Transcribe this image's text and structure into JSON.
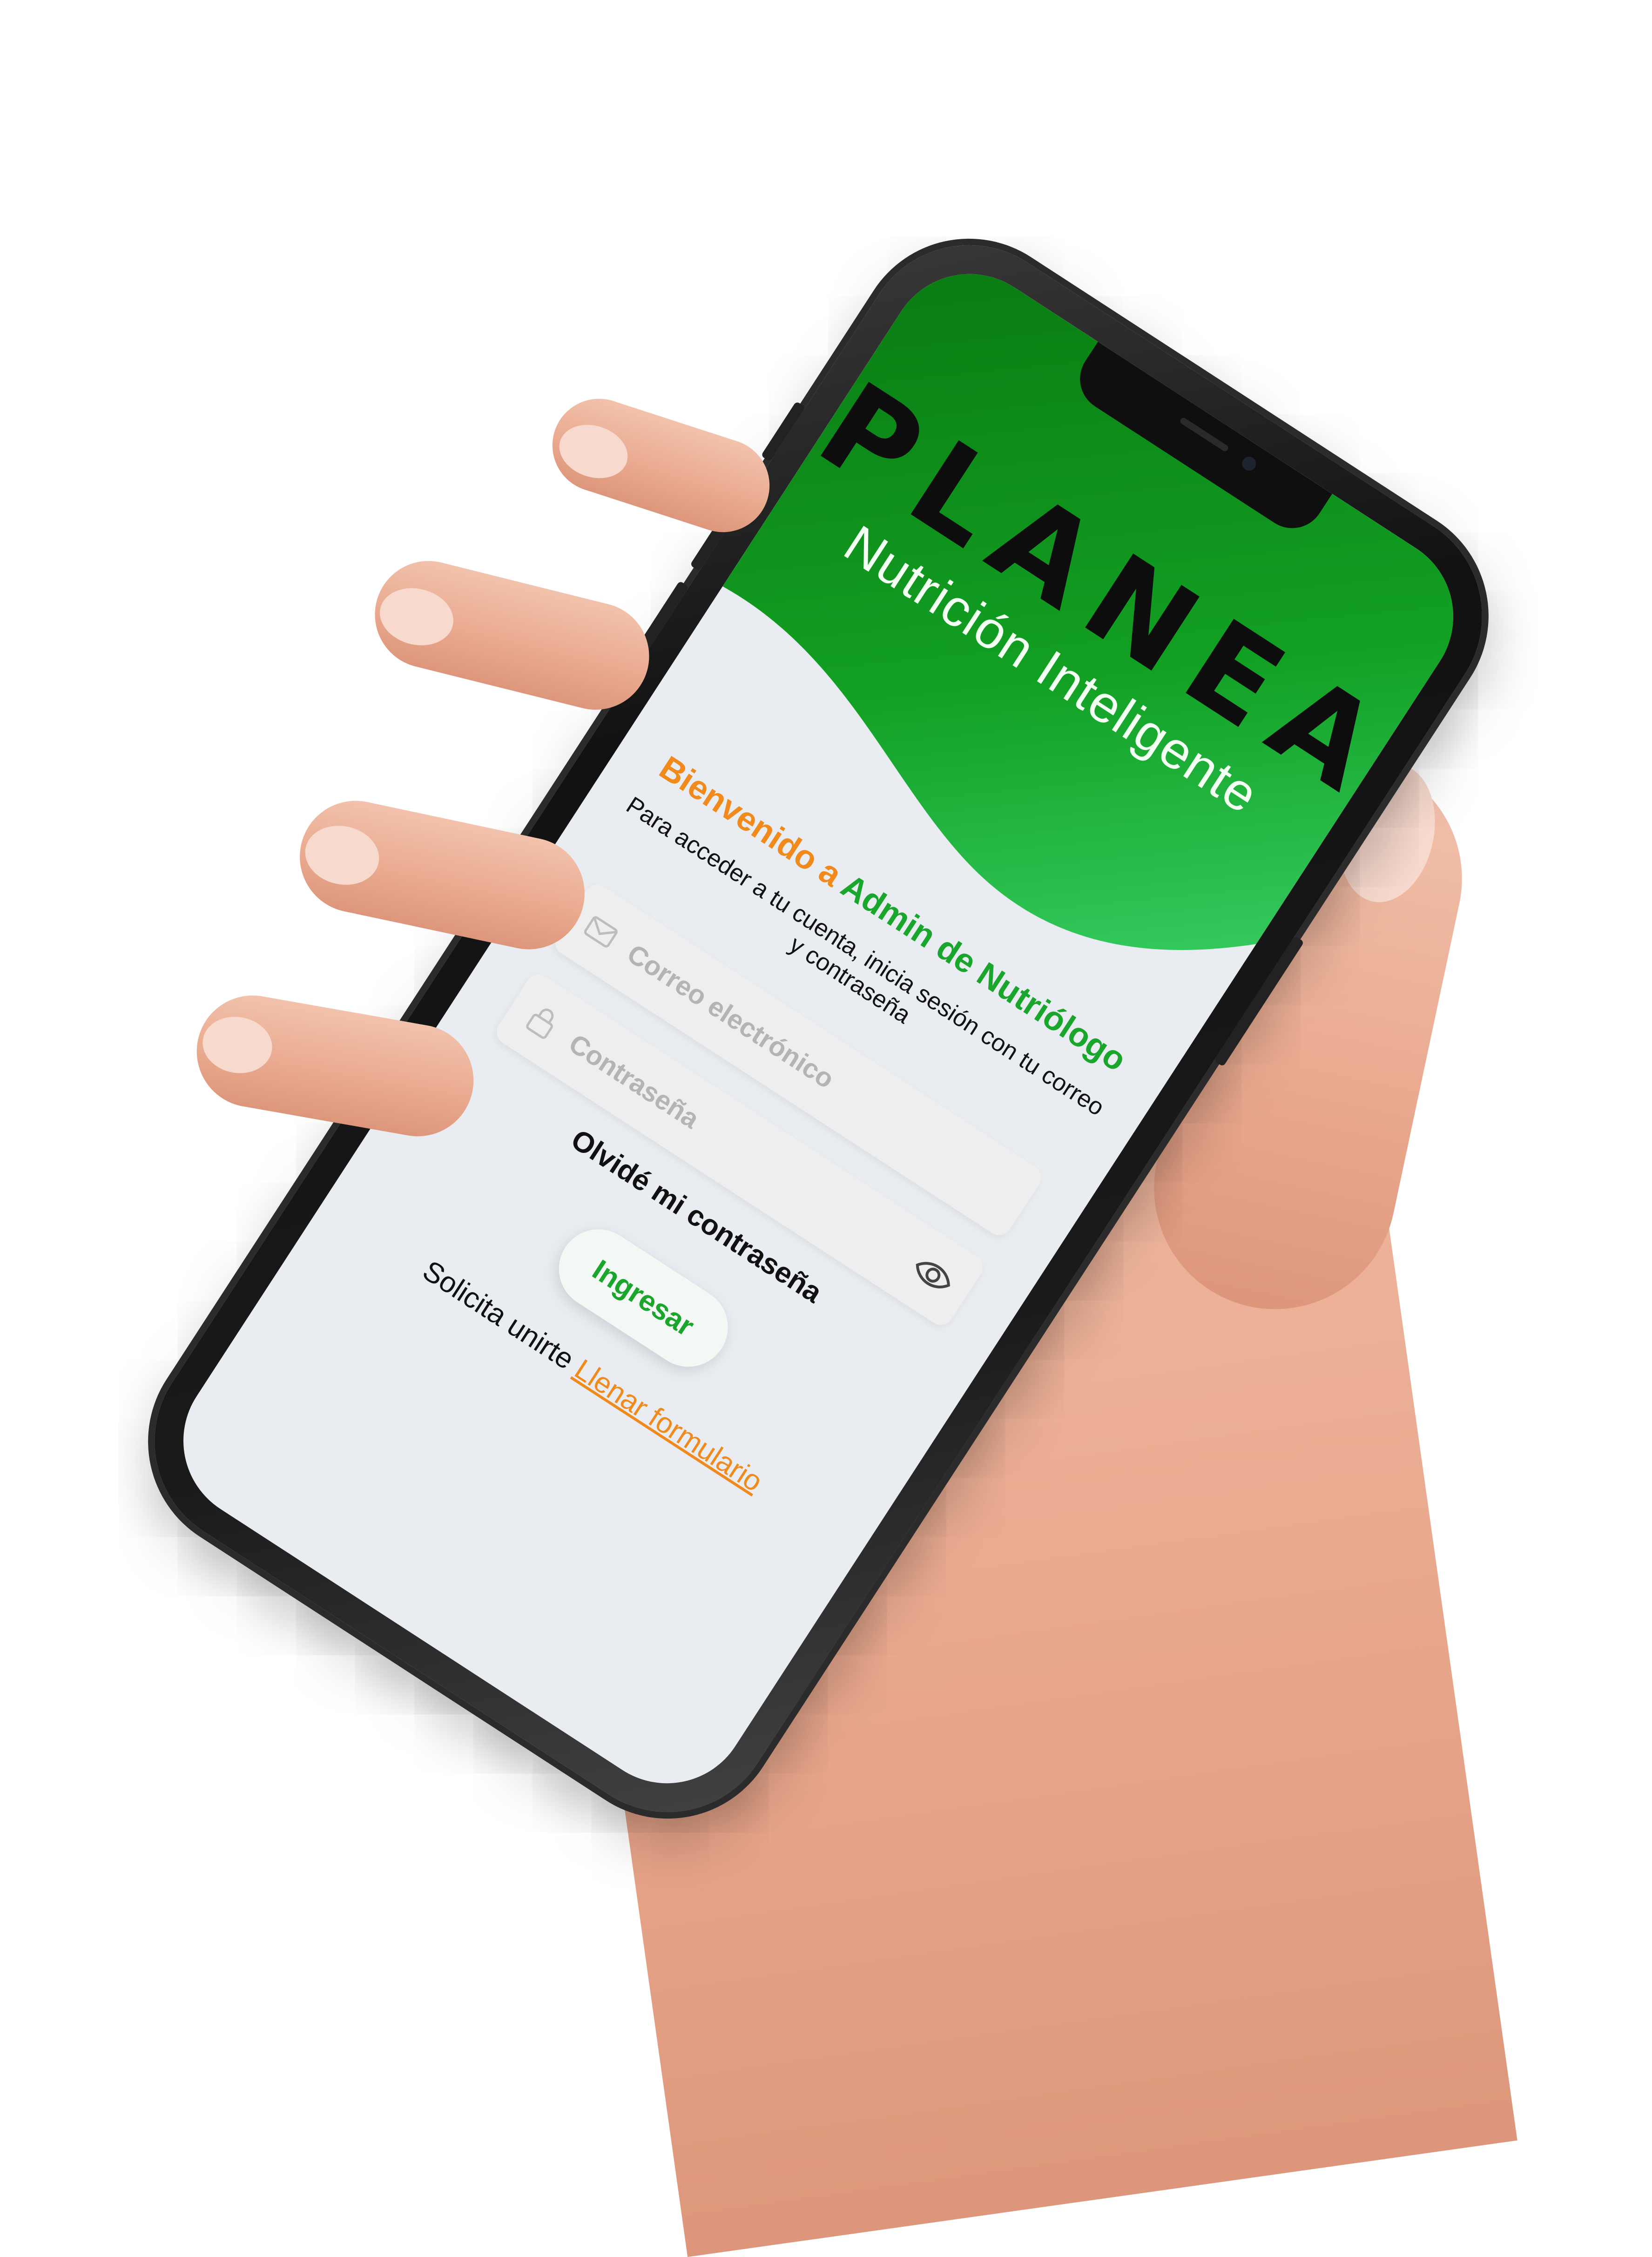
{
  "app": {
    "brand": "PLANEA",
    "tagline": "Nutrición Inteligente",
    "colors": {
      "brand_green": "#1aa52c",
      "header_green_dark": "#0a7a12",
      "header_green_light": "#3bd36b",
      "accent_orange": "#f08a1c",
      "screen_bg": "#e9ecf1"
    }
  },
  "welcome": {
    "prefix": "Bienvenido a",
    "highlight": "Admin de Nutriólogo",
    "subtitle": "Para acceder a tu cuenta, inicia sesión con tu correo y contraseña"
  },
  "form": {
    "email": {
      "placeholder": "Correo electrónico",
      "icon": "mail-icon"
    },
    "password": {
      "placeholder": "Contraseña",
      "icon": "lock-icon",
      "toggle_icon": "eye-icon"
    }
  },
  "actions": {
    "forgot_password": "Olvidé mi contraseña",
    "login_button": "Ingresar",
    "join_text": "Solicita unirte",
    "join_link": "Llenar formulario"
  }
}
